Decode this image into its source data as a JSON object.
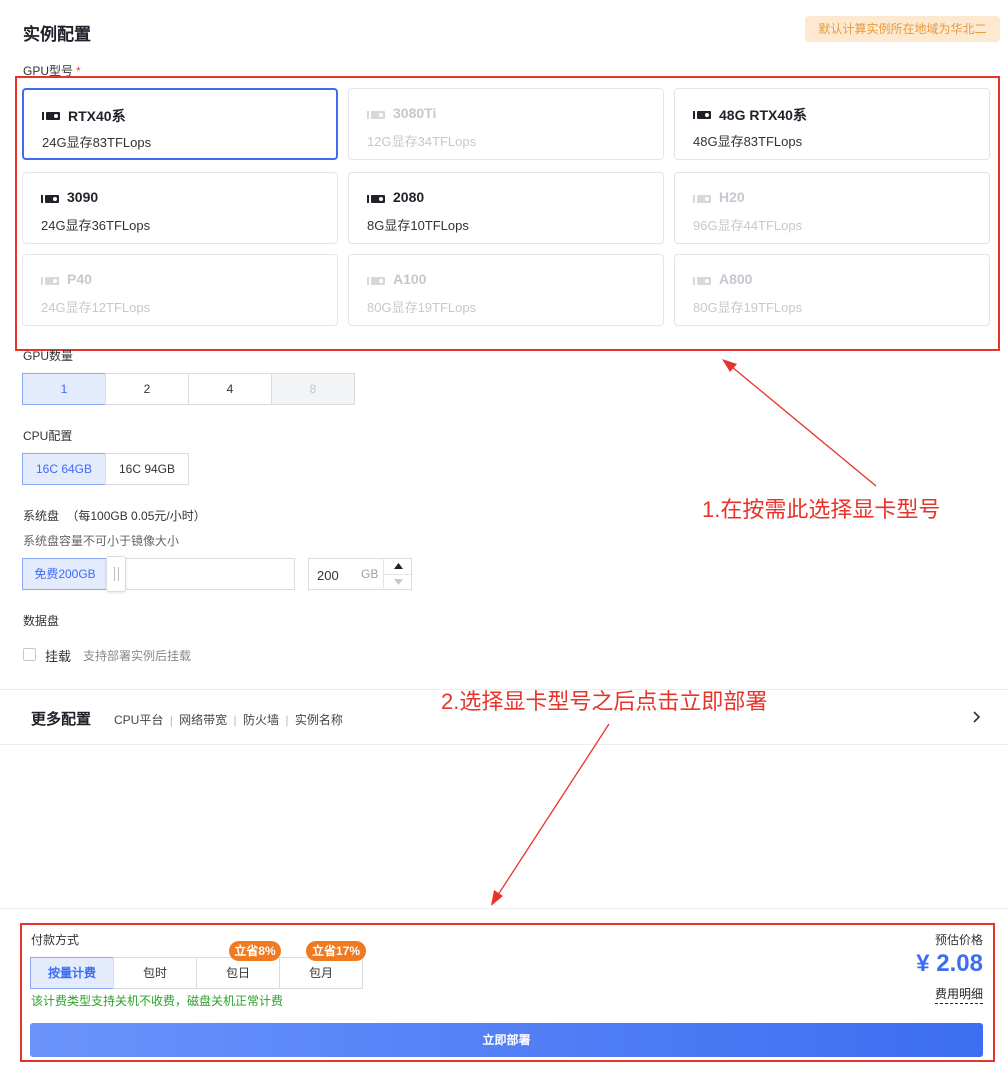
{
  "section": {
    "title": "实例配置",
    "region_badge": "默认计算实例所在地域为华北二"
  },
  "gpu_model": {
    "label": "GPU型号",
    "required_mark": "*",
    "cards": [
      {
        "name": "RTX40系",
        "spec": "24G显存83TFLops",
        "state": "selected"
      },
      {
        "name": "3080Ti",
        "spec": "12G显存34TFLops",
        "state": "disabled"
      },
      {
        "name": "48G RTX40系",
        "spec": "48G显存83TFLops",
        "state": "normal"
      },
      {
        "name": "3090",
        "spec": "24G显存36TFLops",
        "state": "normal"
      },
      {
        "name": "2080",
        "spec": "8G显存10TFLops",
        "state": "normal"
      },
      {
        "name": "H20",
        "spec": "96G显存44TFLops",
        "state": "disabled"
      },
      {
        "name": "P40",
        "spec": "24G显存12TFLops",
        "state": "disabled"
      },
      {
        "name": "A100",
        "spec": "80G显存19TFLops",
        "state": "disabled"
      },
      {
        "name": "A800",
        "spec": "80G显存19TFLops",
        "state": "disabled"
      }
    ]
  },
  "gpu_count": {
    "label": "GPU数量",
    "options": [
      "1",
      "2",
      "4",
      "8"
    ],
    "selected": "1",
    "disabled": [
      "8"
    ]
  },
  "cpu_config": {
    "label": "CPU配置",
    "options": [
      "16C 64GB",
      "16C 94GB"
    ],
    "selected": "16C 64GB"
  },
  "system_disk": {
    "label": "系统盘",
    "price_note": "（每100GB 0.05元/小时）",
    "hint": "系统盘容量不可小于镜像大小",
    "free_label": "免费200GB",
    "value": "200",
    "unit": "GB"
  },
  "data_disk": {
    "label": "数据盘",
    "checkbox_label": "挂载",
    "checkbox_hint": "支持部署实例后挂载"
  },
  "more_config": {
    "title": "更多配置",
    "items": [
      "CPU平台",
      "网络带宽",
      "防火墙",
      "实例名称"
    ],
    "separator": "|"
  },
  "payment": {
    "label": "付款方式",
    "options": [
      "按量计费",
      "包时",
      "包日",
      "包月"
    ],
    "selected": "按量计费",
    "badges": {
      "daily": "立省8%",
      "monthly": "立省17%"
    },
    "note": "该计费类型支持关机不收费，磁盘关机正常计费"
  },
  "price": {
    "label": "预估价格",
    "value": "¥ 2.08",
    "detail_link": "费用明细"
  },
  "deploy_button": "立即部署",
  "annotations": {
    "step1": "1.在按需此选择显卡型号",
    "step2": "2.选择显卡型号之后点击立即部署"
  },
  "colors": {
    "accent": "#3d6df2",
    "annotation": "#e8332a",
    "badge": "#f07a22",
    "note_green": "#2aa32a"
  }
}
